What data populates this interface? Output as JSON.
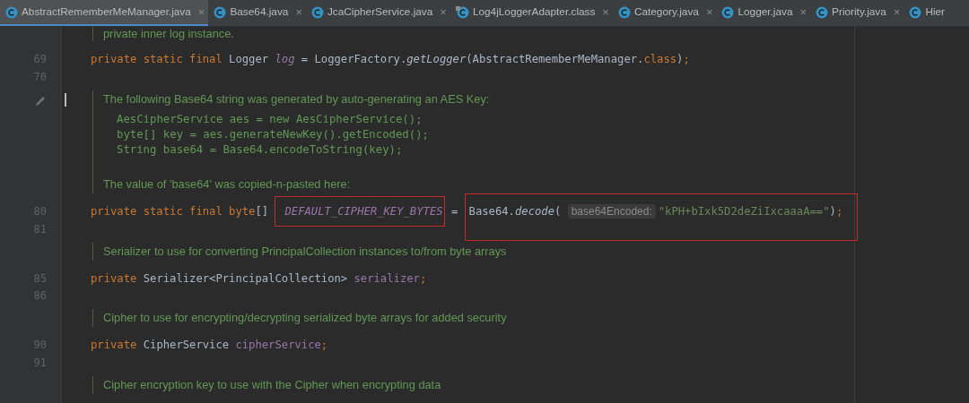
{
  "tabs": [
    {
      "label": "AbstractRememberMeManager.java",
      "kind": "class",
      "selected": true,
      "close": "×"
    },
    {
      "label": "Base64.java",
      "kind": "class",
      "selected": false,
      "close": "×"
    },
    {
      "label": "JcaCipherService.java",
      "kind": "class",
      "selected": false,
      "close": "×"
    },
    {
      "label": "Log4jLoggerAdapter.class",
      "kind": "compiled",
      "selected": false,
      "close": "×"
    },
    {
      "label": "Category.java",
      "kind": "class",
      "selected": false,
      "close": "×"
    },
    {
      "label": "Logger.java",
      "kind": "class",
      "selected": false,
      "close": "×"
    },
    {
      "label": "Priority.java",
      "kind": "class",
      "selected": false,
      "close": "×"
    },
    {
      "label": "Hier",
      "kind": "class",
      "selected": false
    }
  ],
  "editor": {
    "lines": [
      {
        "kind": "doc",
        "paragraphs": [
          {
            "kind": "text",
            "text": "private inner log instance."
          }
        ]
      },
      {
        "kind": "code",
        "number": "69",
        "segments": [
          {
            "annotated": false,
            "tokens": [
              {
                "kind": "keyword",
                "text": "private static final "
              },
              {
                "kind": "plain",
                "text": "Logger "
              },
              {
                "kind": "static-field",
                "text": "log"
              },
              {
                "kind": "plain",
                "text": " = LoggerFactory."
              },
              {
                "kind": "static-call",
                "text": "getLogger"
              },
              {
                "kind": "plain",
                "text": "(AbstractRememberMeManager."
              },
              {
                "kind": "keyword",
                "text": "class"
              },
              {
                "kind": "plain",
                "text": ")"
              },
              {
                "kind": "keyword",
                "text": ";"
              }
            ]
          }
        ]
      },
      {
        "kind": "code",
        "number": "70"
      },
      {
        "kind": "doc",
        "edited": true,
        "cursor": true,
        "paragraphs": [
          {
            "kind": "text",
            "text": "The following Base64 string was generated by auto-generating an AES Key:"
          },
          {
            "kind": "code",
            "lines": [
              "AesCipherService aes = new AesCipherService();",
              "byte[] key = aes.generateNewKey().getEncoded();",
              "String base64 = Base64.encodeToString(key);"
            ]
          },
          {
            "kind": "text",
            "text": "The value of 'base64' was copied-n-pasted here:"
          }
        ]
      },
      {
        "kind": "code",
        "number": "80",
        "segments": [
          {
            "annotated": false,
            "tokens": [
              {
                "kind": "keyword",
                "text": "private static final byte"
              },
              {
                "kind": "plain",
                "text": "[] "
              }
            ]
          },
          {
            "annotated": true,
            "tokens": [
              {
                "kind": "static-field",
                "text": "DEFAULT_CIPHER_KEY_BYTES"
              }
            ]
          },
          {
            "annotated": false,
            "tokens": [
              {
                "kind": "plain",
                "text": " = "
              }
            ]
          },
          {
            "annotated": true,
            "tokens": [
              {
                "kind": "plain",
                "text": "Base64."
              },
              {
                "kind": "static-call",
                "text": "decode"
              },
              {
                "kind": "plain",
                "text": "( "
              },
              {
                "kind": "hint",
                "text": "base64Encoded:"
              },
              {
                "kind": "string",
                "text": "\"kPH+bIxk5D2deZiIxcaaaA==\""
              },
              {
                "kind": "plain",
                "text": ")"
              },
              {
                "kind": "keyword",
                "text": ";"
              }
            ]
          }
        ]
      },
      {
        "kind": "code",
        "number": "81"
      },
      {
        "kind": "doc",
        "paragraphs": [
          {
            "kind": "text",
            "text": "Serializer to use for converting PrincipalCollection instances to/from byte arrays"
          }
        ]
      },
      {
        "kind": "code",
        "number": "85",
        "segments": [
          {
            "annotated": false,
            "tokens": [
              {
                "kind": "keyword",
                "text": "private "
              },
              {
                "kind": "plain",
                "text": "Serializer<PrincipalCollection> "
              },
              {
                "kind": "field",
                "text": "serializer"
              },
              {
                "kind": "keyword",
                "text": ";"
              }
            ]
          }
        ]
      },
      {
        "kind": "code",
        "number": "86"
      },
      {
        "kind": "doc",
        "paragraphs": [
          {
            "kind": "text",
            "text": "Cipher to use for encrypting/decrypting serialized byte arrays for added security"
          }
        ]
      },
      {
        "kind": "code",
        "number": "90",
        "segments": [
          {
            "annotated": false,
            "tokens": [
              {
                "kind": "keyword",
                "text": "private "
              },
              {
                "kind": "plain",
                "text": "CipherService "
              },
              {
                "kind": "field",
                "text": "cipherService"
              },
              {
                "kind": "keyword",
                "text": ";"
              }
            ]
          }
        ]
      },
      {
        "kind": "code",
        "number": "91"
      },
      {
        "kind": "doc",
        "paragraphs": [
          {
            "kind": "text",
            "text": "Cipher encryption key to use with the Cipher when encrypting data"
          }
        ]
      }
    ]
  }
}
